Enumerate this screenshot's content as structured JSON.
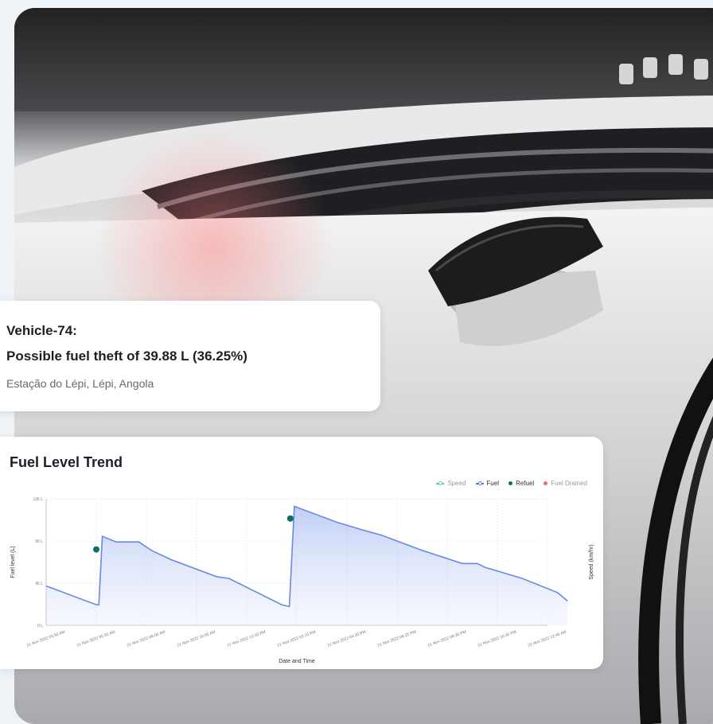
{
  "alert": {
    "vehicle": "Vehicle-74:",
    "message": "Possible fuel theft of 39.88 L (36.25%)",
    "location": "Estação do Lépi, Lépi, Angola"
  },
  "chart": {
    "title": "Fuel Level Trend",
    "legend": [
      {
        "label": "Speed",
        "color": "#5fc9a8",
        "style": "line"
      },
      {
        "label": "Fuel",
        "color": "#5a7bd6",
        "style": "line"
      },
      {
        "label": "Refuel",
        "color": "#0e6e66",
        "style": "dot"
      },
      {
        "label": "Fuel Drained",
        "color": "#f06a6a",
        "style": "dot"
      }
    ],
    "ylabel_left": "Fuel level (L)",
    "ylabel_right": "Speed (km/hr)",
    "xlabel": "Date and Time"
  },
  "chart_data": {
    "type": "line",
    "title": "Fuel Level Trend",
    "xlabel": "Date and Time",
    "ylabel": "Fuel level (L)",
    "y_ticks": [
      "0 L",
      "45 L",
      "90 L",
      "135 L"
    ],
    "ylim": [
      0,
      135
    ],
    "x_ticks": [
      "21 Nov 2022 03:50 AM",
      "21 Nov 2022 05:55 AM",
      "21 Nov 2022 08:00 AM",
      "21 Nov 2022 10:05 AM",
      "21 Nov 2022 12:10 PM",
      "21 Nov 2022 02:15 PM",
      "21 Nov 2022 04:20 PM",
      "21 Nov 2022 06:25 PM",
      "21 Nov 2022 08:30 PM",
      "21 Nov 2022 10:35 PM",
      "22 Nov 2022 12:40 AM"
    ],
    "series": [
      {
        "name": "Fuel",
        "x": [
          0,
          1.0,
          1.05,
          1.12,
          1.4,
          1.55,
          1.85,
          2.1,
          2.5,
          3.4,
          3.65,
          4.7,
          4.85,
          4.95,
          5.8,
          6.3,
          6.7,
          7.5,
          8.3,
          8.6,
          8.75,
          9.5,
          10.2,
          10.4
        ],
        "values": [
          42,
          22,
          22,
          95,
          89,
          89,
          89,
          80,
          70,
          52,
          50,
          22,
          20,
          127,
          110,
          102,
          96,
          80,
          66,
          66,
          62,
          50,
          35,
          26
        ]
      }
    ],
    "refuel_points": [
      {
        "x": 1.0,
        "value": 81
      },
      {
        "x": 4.87,
        "value": 114
      }
    ]
  }
}
